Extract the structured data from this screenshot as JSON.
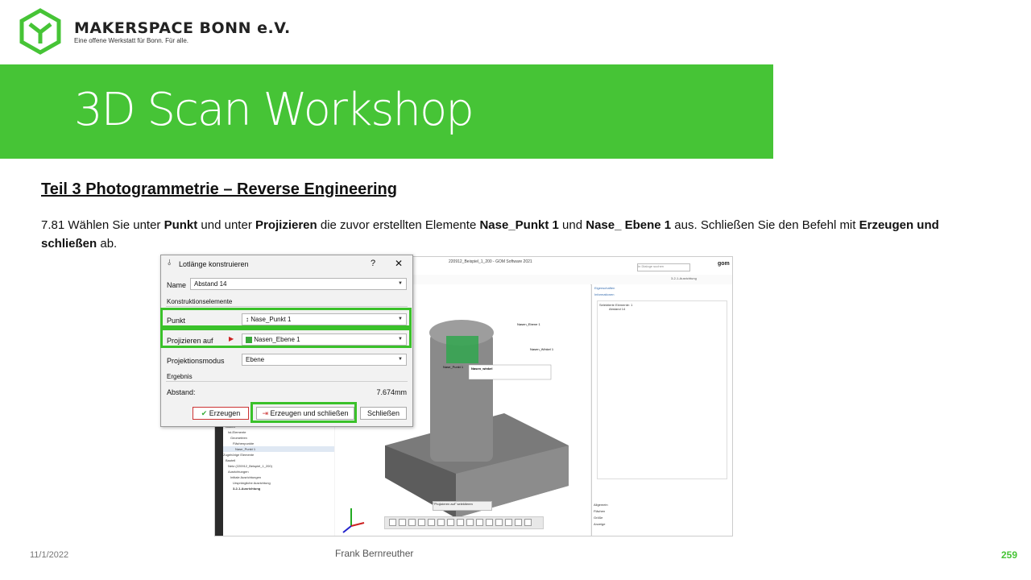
{
  "header": {
    "org_name": "MAKERSPACE BONN e.V.",
    "org_tagline": "Eine offene Werkstatt für Bonn. Für alle.",
    "banner_title": "3D Scan Workshop",
    "brand_color": "#46c436"
  },
  "content": {
    "section_title": "Teil 3  Photogrammetrie  – Reverse Engineering",
    "step_prefix": "7.81 Wählen Sie unter ",
    "step_b1": "Punkt",
    "step_t2": " und unter ",
    "step_b2": "Projizieren",
    "step_t3": " die zuvor erstellten Elemente ",
    "step_b3": "Nase_Punkt 1",
    "step_t4": " und ",
    "step_b4": "Nase_ Ebene 1",
    "step_t5": " aus. Schließen Sie den Befehl mit ",
    "step_b5": "Erzeugen und schließen",
    "step_t6": " ab."
  },
  "dialog": {
    "title": "Lotlänge konstruieren",
    "help": "?",
    "close": "✕",
    "name_label": "Name",
    "name_value": "Abstand 14",
    "section_construct": "Konstruktionselemente",
    "punkt_label": "Punkt",
    "punkt_value": "Nase_Punkt 1",
    "proj_label": "Projizieren auf",
    "proj_value": "Nasen_Ebene 1",
    "mode_label": "Projektionsmodus",
    "mode_value": "Ebene",
    "section_result": "Ergebnis",
    "distance_label": "Abstand:",
    "distance_value": "7.674mm",
    "btn_create": "Erzeugen",
    "btn_create_close": "Erzeugen und schließen",
    "btn_close": "Schließen"
  },
  "software": {
    "window_title": "220912_Beispiel_1_200 - GOM Software 2021",
    "search_placeholder": "In Dialoge suchen",
    "logo": "gom",
    "alignment_label": "3-2-1-Ausrichtung",
    "rp_tab": "Eigenschaften",
    "rp_info": "Informationen",
    "rp_selected": "Selektierte Elemente: 1",
    "rp_selected_item": "Abstand 14",
    "rp_bottom": [
      "Allgemein",
      "Flächen",
      "Größe",
      "Anzeige"
    ],
    "label_nase_ebene": "Nasen_Ebene 1",
    "label_nase_winkel": "Nasen_Winkel 1",
    "label_nase_punkt": "Nase_Punkt 1",
    "label_winkel_table": "Nasen_winkel",
    "hint": "\"Projizieren auf\" selektieren",
    "tree": [
      "Zugehörige Elemente (1)",
      "Bauteil",
      "Ist-Elemente",
      "Geometrien",
      "Flächenpunkte",
      "Nase_Punkt 1",
      "Zugehörige Elemente",
      "Bauteil",
      "Netz (220912_Beispiel_1_200)",
      "Ausrichtungen",
      "Initiale Ausrichtungen",
      "Ursprüngliche Ausrichtung",
      "3-2-1-Ausrichtung"
    ]
  },
  "footer": {
    "date": "11/1/2022",
    "author": "Frank Bernreuther",
    "page": "259"
  }
}
